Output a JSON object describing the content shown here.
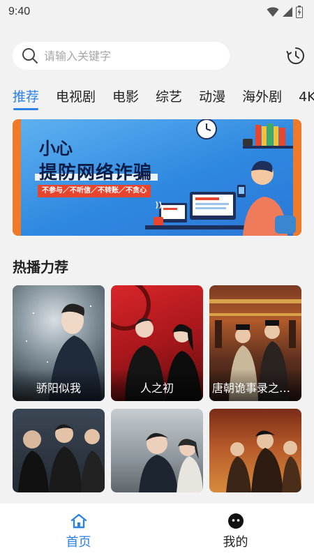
{
  "status_bar": {
    "time": "9:40",
    "icons": [
      "wifi-icon",
      "signal-icon",
      "battery-icon"
    ]
  },
  "search": {
    "placeholder": "请输入关键字",
    "value": "",
    "history_icon": "history-icon"
  },
  "tabs": [
    {
      "label": "推荐",
      "active": true
    },
    {
      "label": "电视剧",
      "active": false
    },
    {
      "label": "电影",
      "active": false
    },
    {
      "label": "综艺",
      "active": false
    },
    {
      "label": "动漫",
      "active": false
    },
    {
      "label": "海外剧",
      "active": false
    },
    {
      "label": "4K",
      "active": false
    }
  ],
  "banner": {
    "line1": "小心",
    "line2": "提防网络诈骗",
    "subtitle": "不参与／不听信／不转账／不贪心"
  },
  "section": {
    "title": "热播力荐"
  },
  "cards": [
    {
      "title": "骄阳似我"
    },
    {
      "title": "人之初"
    },
    {
      "title": "唐朝诡事录之长安"
    },
    {
      "title": ""
    },
    {
      "title": ""
    },
    {
      "title": ""
    }
  ],
  "bottom_nav": [
    {
      "label": "首页",
      "icon": "home-icon",
      "active": true
    },
    {
      "label": "我的",
      "icon": "profile-icon",
      "active": false
    }
  ],
  "colors": {
    "accent": "#2a82e4",
    "background": "#f2f2f2",
    "banner_blue": "#2f88e0",
    "banner_orange": "#ef7a2a"
  }
}
